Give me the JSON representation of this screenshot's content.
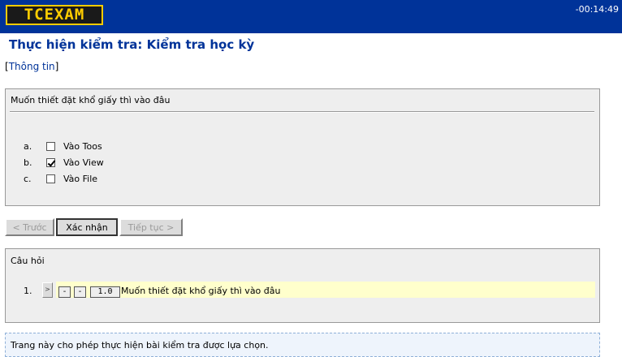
{
  "header": {
    "logo_text": "TCEXAM",
    "timer": "-00:14:49",
    "bar_color": "#003399",
    "logo_color": "#ffcc00"
  },
  "page_title": "Thực hiện kiểm tra: Kiểm tra học kỳ",
  "info_link": {
    "open": "[",
    "label": "Thông tin",
    "close": "]"
  },
  "question": {
    "text": "Muốn thiết đặt khổ giấy thì vào đâu",
    "answers": [
      {
        "letter": "a.",
        "label": "Vào Toos",
        "checked": false
      },
      {
        "letter": "b.",
        "label": "Vào View",
        "checked": true
      },
      {
        "letter": "c.",
        "label": "Vào File",
        "checked": false
      }
    ]
  },
  "buttons": {
    "prev": "< Trước",
    "confirm": "Xác nhận",
    "next": "Tiếp tục >"
  },
  "question_list": {
    "title": "Câu hỏi",
    "items": [
      {
        "num": "1.",
        "select": ">",
        "mark1": "-",
        "mark2": "-",
        "score": "1.0",
        "text": "Muốn thiết đặt khổ giấy thì vào đâu"
      }
    ]
  },
  "footer": "Trang này cho phép thực hiện bài kiểm tra được lựa chọn."
}
